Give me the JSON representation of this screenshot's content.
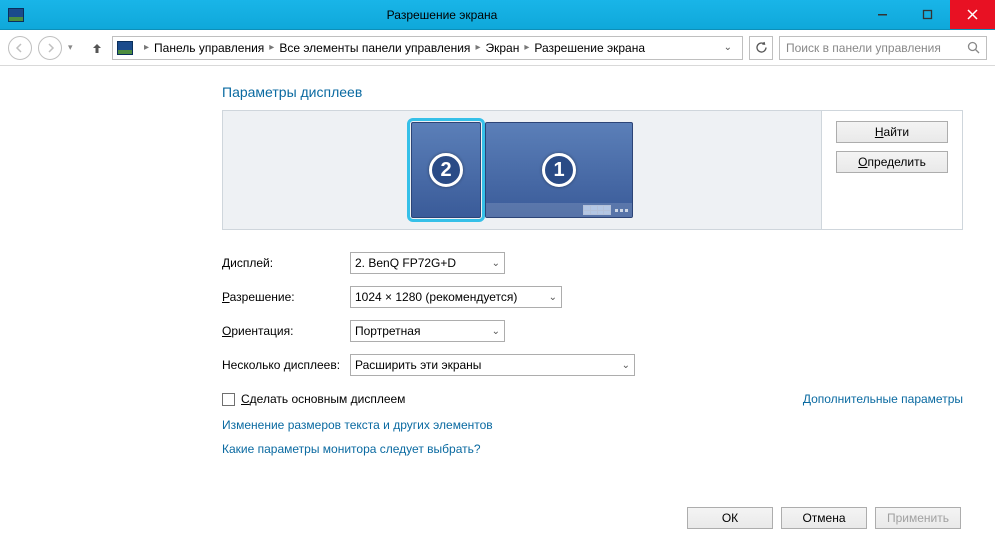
{
  "window": {
    "title": "Разрешение экрана"
  },
  "breadcrumb": {
    "items": [
      "Панель управления",
      "Все элементы панели управления",
      "Экран",
      "Разрешение экрана"
    ]
  },
  "search": {
    "placeholder": "Поиск в панели управления"
  },
  "heading": "Параметры дисплеев",
  "arrange": {
    "find": "Найти",
    "identify": "Определить",
    "monitor1": "1",
    "monitor2": "2"
  },
  "labels": {
    "display": "Дисплей:",
    "resolution": "Разрешение:",
    "orientation": "Ориентация:",
    "multiple": "Несколько дисплеев:"
  },
  "selects": {
    "display": "2. BenQ FP72G+D",
    "resolution": "1024 × 1280 (рекомендуется)",
    "orientation": "Портретная",
    "multiple": "Расширить эти экраны"
  },
  "checkbox": {
    "makeMain": "Сделать основным дисплеем"
  },
  "links": {
    "advanced": "Дополнительные параметры",
    "textSize": "Изменение размеров текста и других элементов",
    "whichMonitor": "Какие параметры монитора следует выбрать?"
  },
  "footer": {
    "ok": "ОК",
    "cancel": "Отмена",
    "apply": "Применить"
  }
}
